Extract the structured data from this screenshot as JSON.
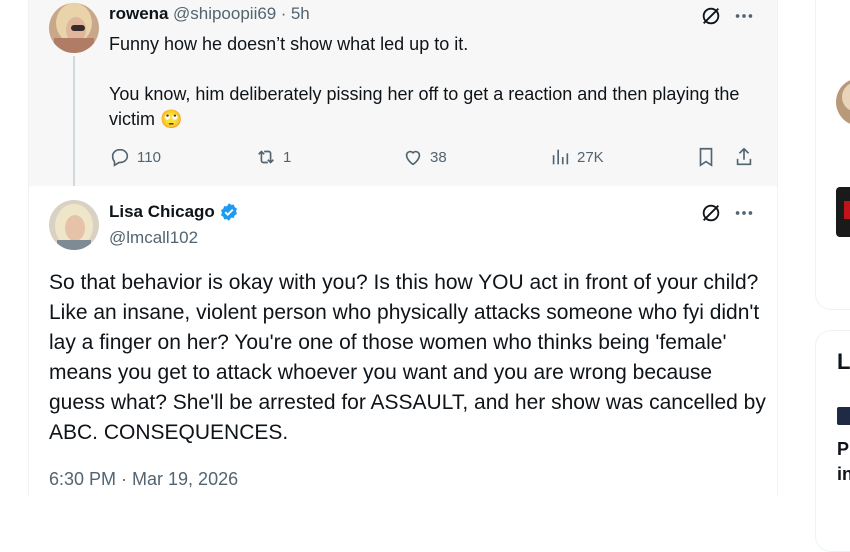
{
  "reply": {
    "display_name": "rowena",
    "handle": "@shipoopii69",
    "separator": "·",
    "time": "5h",
    "text_line1": "Funny how he doesn’t show what led up to it.",
    "text_line2": "You know, him deliberately pissing her off to get a reaction and then playing the victim",
    "emoji": "🙄",
    "stats": {
      "replies": "110",
      "reposts": "1",
      "likes": "38",
      "views": "27K"
    }
  },
  "main_tweet": {
    "display_name": "Lisa Chicago",
    "handle": "@lmcall102",
    "verified": true,
    "text": "So that behavior is okay with you? Is this how YOU act in front of your child? Like an insane, violent person who physically attacks someone who fyi didn't lay a finger on her? You're one of those women who thinks being 'female' means you get to attack whoever you want and you are wrong because guess what? She'll be arrested for ASSAULT, and her show was cancelled by ABC. CONSEQUENCES.",
    "timestamp": "6:30 PM · Mar 19, 2026"
  },
  "sidebar": {
    "partial_heading": "L",
    "partial_text_1": "Pr",
    "partial_text_2": "in"
  },
  "colors": {
    "verified_badge": "#1d9bf0",
    "muted_text": "#536471",
    "reply_background": "#f7f7f7",
    "thread_line": "#cfd9de"
  }
}
